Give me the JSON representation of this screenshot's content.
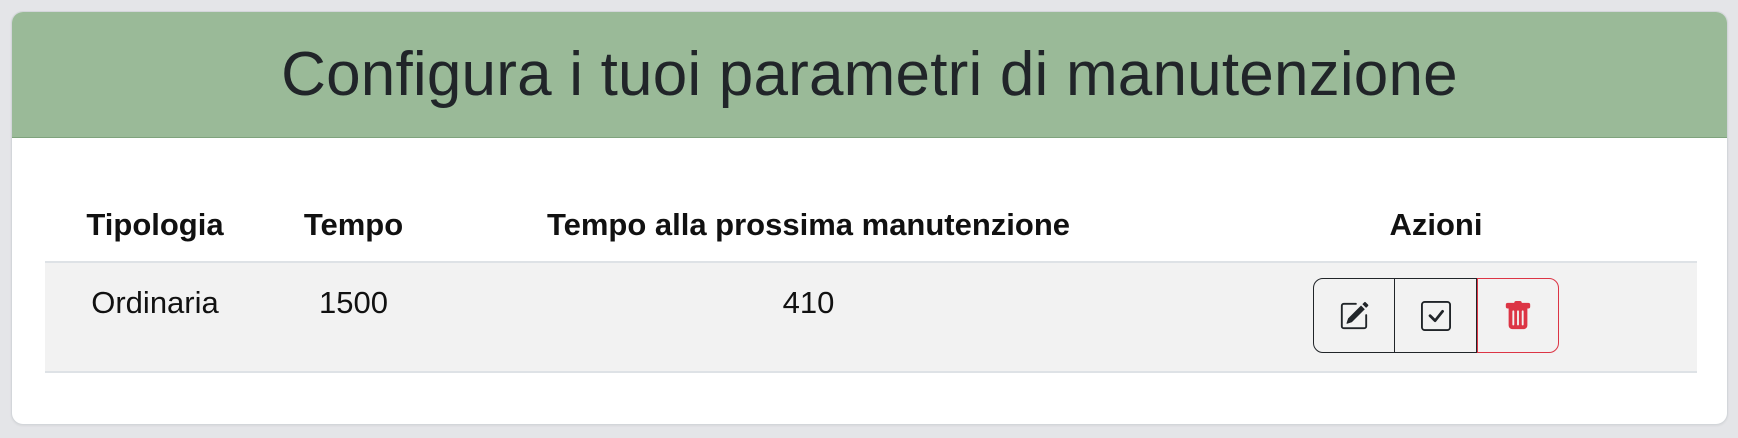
{
  "header": {
    "title": "Configura i tuoi parametri di manutenzione"
  },
  "table": {
    "columns": [
      "Tipologia",
      "Tempo",
      "Tempo alla prossima manutenzione",
      "Azioni"
    ],
    "rows": [
      {
        "tipologia": "Ordinaria",
        "tempo": "1500",
        "tempo_prossima": "410",
        "actions": [
          "edit-icon",
          "check-square-icon",
          "trash-icon"
        ]
      }
    ]
  },
  "colors": {
    "header_bg": "#9aba98",
    "row_bg": "#f2f2f2",
    "danger": "#dc3545",
    "dark": "#212529"
  }
}
